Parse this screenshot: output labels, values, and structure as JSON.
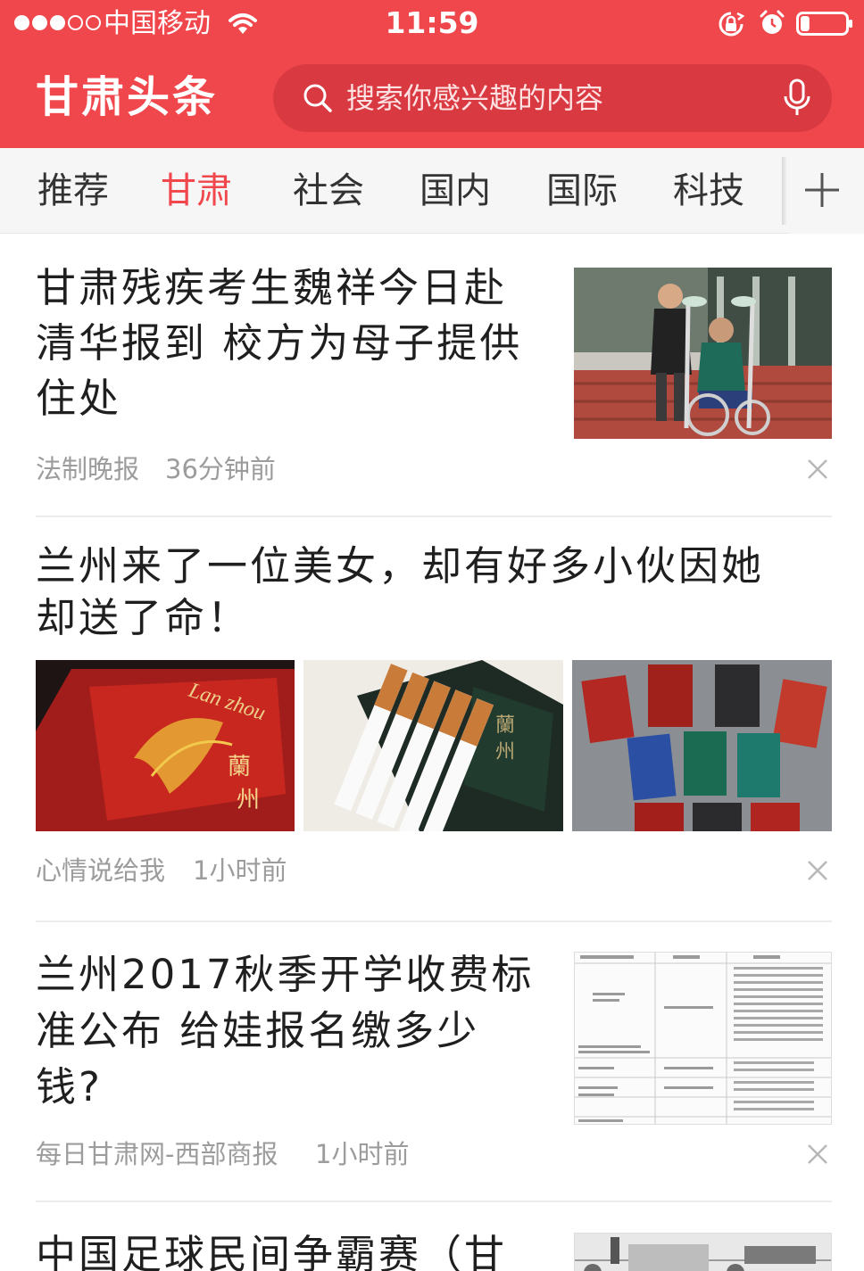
{
  "status_bar": {
    "carrier": "中国移动",
    "time": "11:59",
    "signal_dots": 5,
    "signal_filled": 3,
    "battery_level": 0.2
  },
  "app_bar": {
    "logo": "甘肃头条",
    "search_placeholder": "搜索你感兴趣的内容"
  },
  "tabs": [
    {
      "label": "推荐",
      "active": false
    },
    {
      "label": "甘肃",
      "active": true
    },
    {
      "label": "社会",
      "active": false
    },
    {
      "label": "国内",
      "active": false
    },
    {
      "label": "国际",
      "active": false
    },
    {
      "label": "科技",
      "active": false
    }
  ],
  "articles": [
    {
      "title_lines": [
        "甘肃残疾考生魏祥今日赴",
        "清华报到 校方为母子提供",
        "住处"
      ],
      "source": "法制晚报",
      "time": "36分钟前",
      "image": "woman-pushing-wheelchair-student"
    },
    {
      "title_lines": [
        "兰州来了一位美女，却有好多小伙因她",
        "却送了命！"
      ],
      "source": "心情说给我",
      "time": "1小时前",
      "images": [
        "lanzhou-cigarette-pack-red",
        "cigarettes-and-box",
        "cigarette-packs-table"
      ]
    },
    {
      "title_lines": [
        "兰州2017秋季开学收费标",
        "准公布 给娃报名缴多少",
        "钱?"
      ],
      "source": "每日甘肃网-西部商报",
      "time": "1小时前",
      "image": "fee-document-table"
    },
    {
      "title_lines": [
        "中国足球民间争霸赛（甘"
      ],
      "image": "football-team-photo"
    }
  ],
  "colors": {
    "brand_red": "#f0474d",
    "search_bg": "#d93940",
    "meta_gray": "#9c9c9c",
    "active_tab": "#f0474d"
  }
}
